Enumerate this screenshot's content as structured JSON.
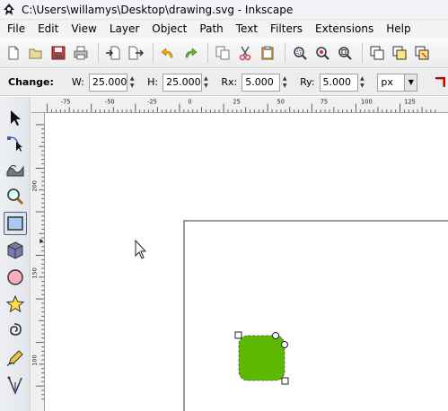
{
  "window": {
    "title": "C:\\Users\\willamys\\Desktop\\drawing.svg - Inkscape"
  },
  "menubar": {
    "items": [
      "File",
      "Edit",
      "View",
      "Layer",
      "Object",
      "Path",
      "Text",
      "Filters",
      "Extensions",
      "Help"
    ]
  },
  "toolbar": {
    "icons": [
      "new-document-icon",
      "open-icon",
      "save-icon",
      "print-icon",
      "import-icon",
      "export-icon",
      "undo-icon",
      "redo-icon",
      "copy-icon",
      "cut-icon",
      "paste-icon",
      "zoom-selection-icon",
      "zoom-drawing-icon",
      "zoom-page-icon",
      "duplicate-icon",
      "clone-icon",
      "unlink-clone-icon"
    ]
  },
  "controls": {
    "mode_label": "Change:",
    "w_label": "W:",
    "w_value": "25.000",
    "h_label": "H:",
    "h_value": "25.000",
    "rx_label": "Rx:",
    "rx_value": "5.000",
    "ry_label": "Ry:",
    "ry_value": "5.000",
    "unit": "px"
  },
  "tools": [
    "selector-tool",
    "node-tool",
    "tweak-tool",
    "zoom-tool",
    "rectangle-tool",
    "3d-box-tool",
    "ellipse-tool",
    "star-tool",
    "spiral-tool",
    "pencil-tool",
    "pen-tool"
  ],
  "active_tool": "rectangle-tool",
  "ruler": {
    "h_labels": [
      "-75",
      "-50",
      "-25",
      "0",
      "25",
      "50",
      "75",
      "100",
      "125"
    ],
    "v_labels": [
      "200",
      "150",
      "100"
    ]
  },
  "colors": {
    "shape_fill": "#5cb800",
    "accent_red": "#c00000"
  }
}
